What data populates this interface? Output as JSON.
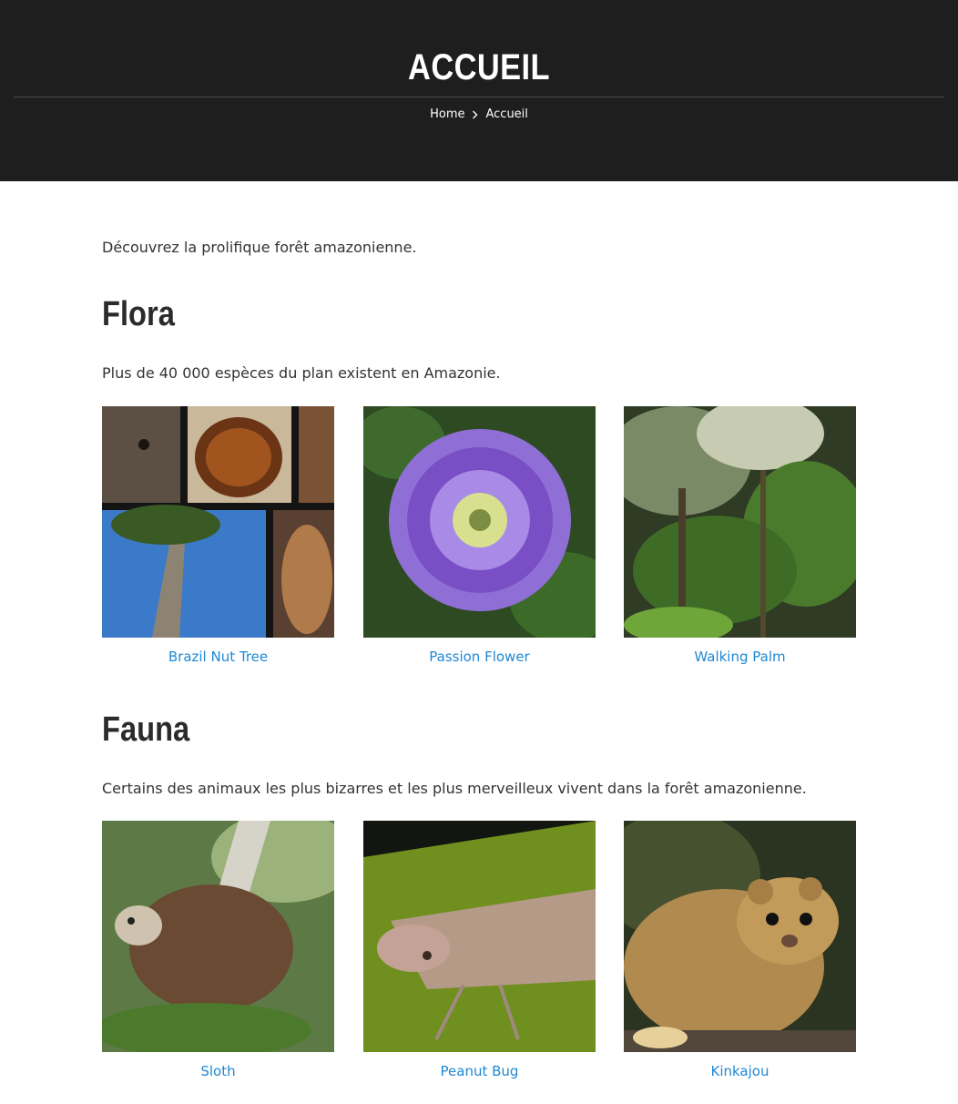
{
  "hero": {
    "title": "ACCUEIL",
    "breadcrumb": {
      "home": "Home",
      "current": "Accueil"
    }
  },
  "intro": "Découvrez la prolifique forêt amazonienne.",
  "flora": {
    "heading": "Flora",
    "description": "Plus de 40 000 espèces du plan existent en Amazonie.",
    "items": [
      {
        "label": "Brazil Nut Tree"
      },
      {
        "label": "Passion Flower"
      },
      {
        "label": "Walking Palm"
      }
    ]
  },
  "fauna": {
    "heading": "Fauna",
    "description": "Certains des animaux les plus bizarres et les plus merveilleux vivent dans la forêt amazonienne.",
    "items": [
      {
        "label": "Sloth"
      },
      {
        "label": "Peanut Bug"
      },
      {
        "label": "Kinkajou"
      }
    ]
  },
  "colors": {
    "hero_bg": "#1f1e1f",
    "link": "#1e88d4",
    "text": "#333333"
  }
}
